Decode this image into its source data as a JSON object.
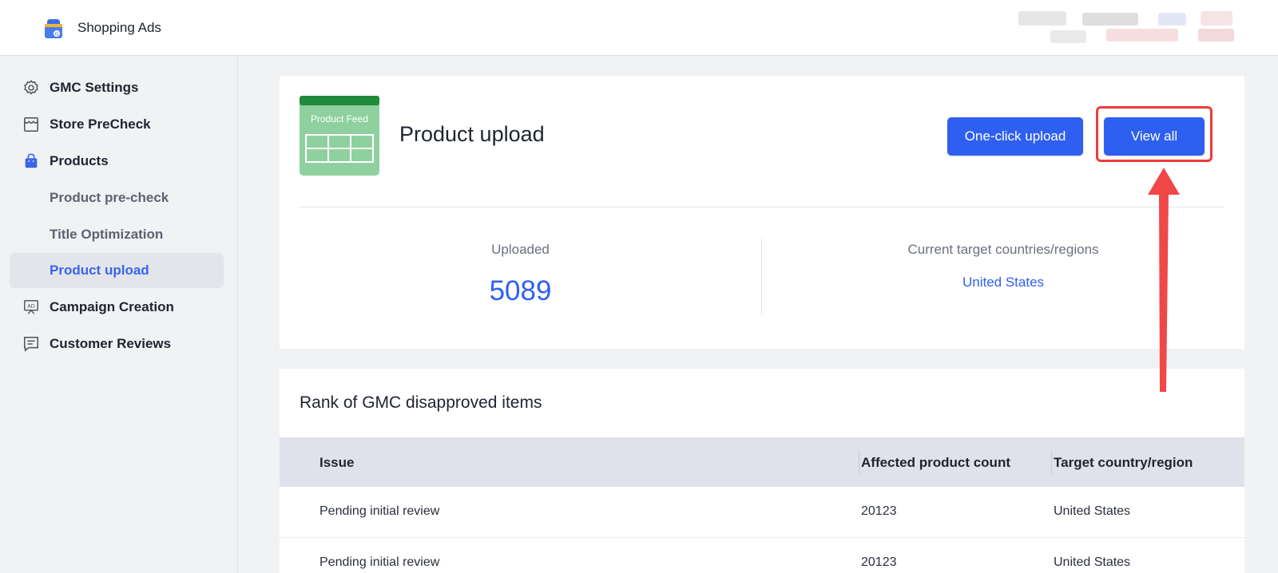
{
  "header": {
    "app_title": "Shopping Ads"
  },
  "sidebar": {
    "items": [
      {
        "label": "GMC Settings",
        "icon": "gear-icon"
      },
      {
        "label": "Store PreCheck",
        "icon": "store-icon"
      },
      {
        "label": "Products",
        "icon": "shopping-bag-icon"
      },
      {
        "label": "Product pre-check"
      },
      {
        "label": "Title Optimization"
      },
      {
        "label": "Product upload",
        "active": true
      },
      {
        "label": "Campaign Creation",
        "icon": "ad-board-icon"
      },
      {
        "label": "Customer Reviews",
        "icon": "review-icon"
      }
    ]
  },
  "upload": {
    "feed_label": "Product Feed",
    "title": "Product upload",
    "one_click_label": "One-click upload",
    "view_all_label": "View all",
    "uploaded_label": "Uploaded",
    "uploaded_value": "5089",
    "countries_label": "Current target countries/regions",
    "countries_value": "United States"
  },
  "rank": {
    "title": "Rank of GMC disapproved items",
    "columns": [
      "Issue",
      "Affected product count",
      "Target country/region"
    ],
    "rows": [
      [
        "Pending initial review",
        "20123",
        "United States"
      ],
      [
        "Pending initial review",
        "20123",
        "United States"
      ]
    ]
  },
  "colors": {
    "accent": "#2e5ff0",
    "highlight": "#ee3b3b",
    "feed_green": "#8fd19e"
  }
}
